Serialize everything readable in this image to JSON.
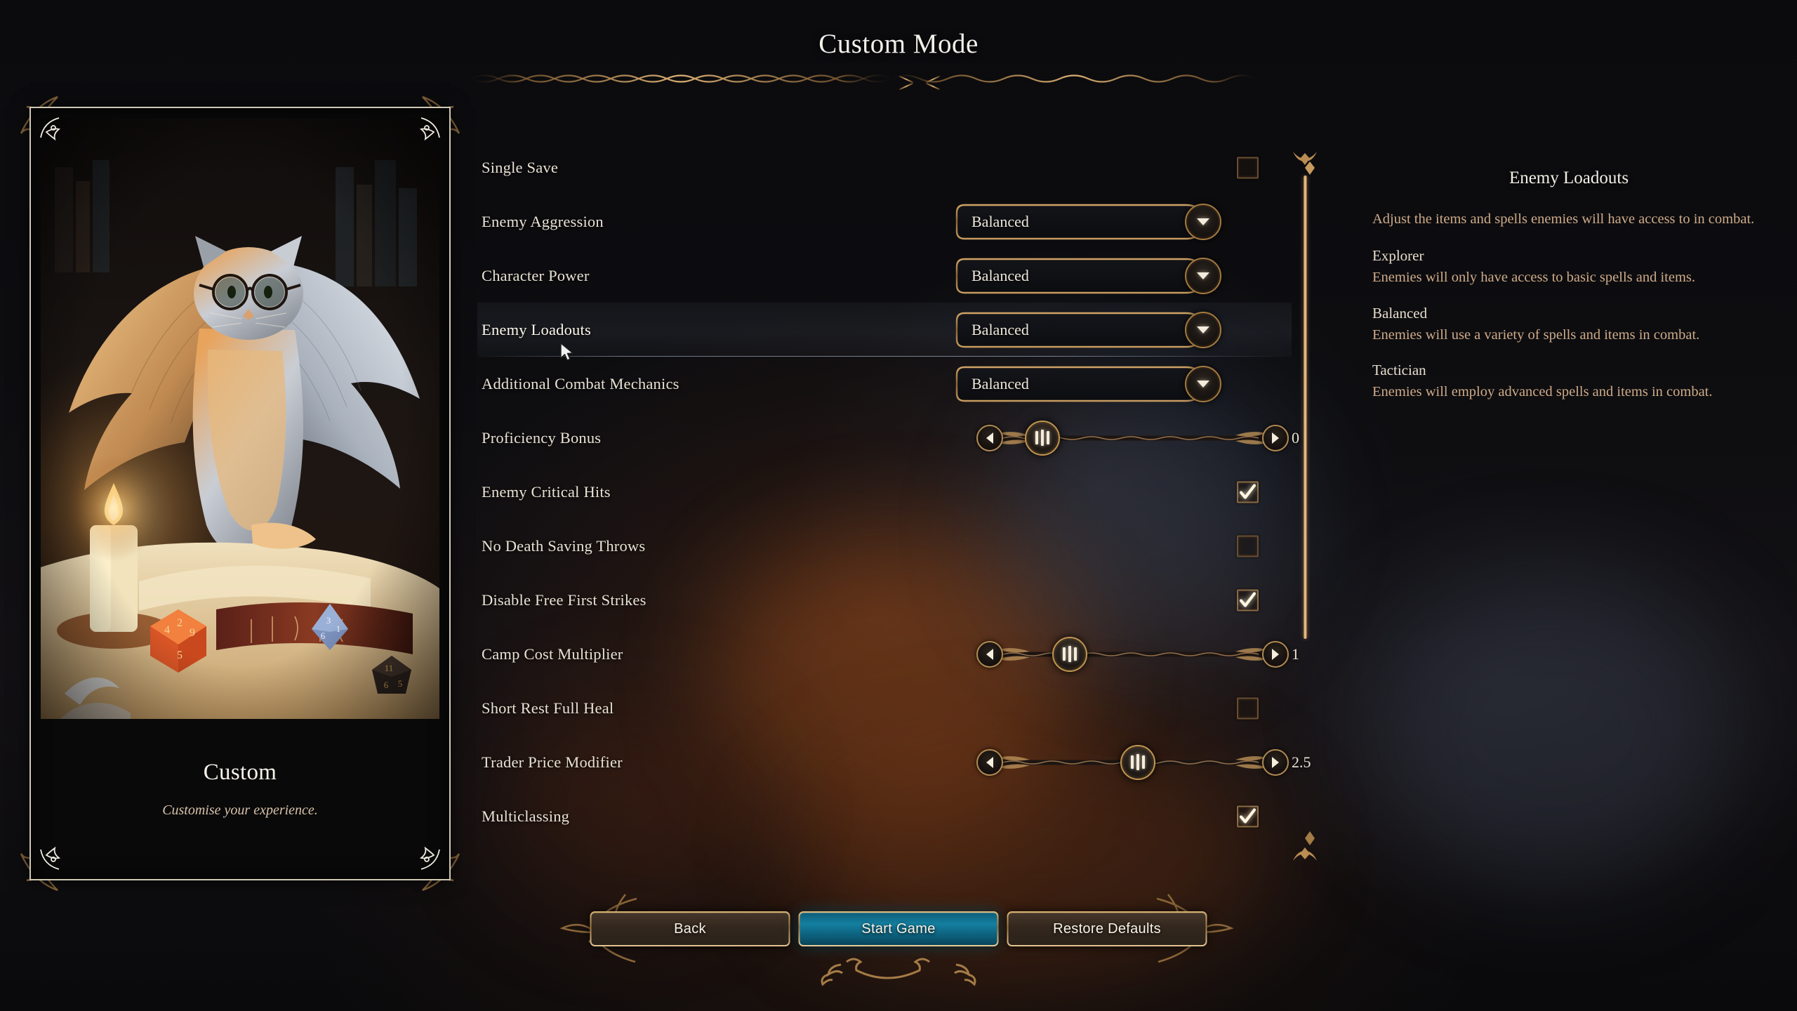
{
  "page": {
    "title": "Custom Mode"
  },
  "card": {
    "title": "Custom",
    "subtitle": "Customise your experience.",
    "artwork_name": "tressym-winged-cat-study-artwork"
  },
  "settings": [
    {
      "label": "Single Save",
      "type": "checkbox",
      "checked": false,
      "hover": false
    },
    {
      "label": "Enemy Aggression",
      "type": "dropdown",
      "value": "Balanced",
      "hover": false
    },
    {
      "label": "Character Power",
      "type": "dropdown",
      "value": "Balanced",
      "hover": false
    },
    {
      "label": "Enemy Loadouts",
      "type": "dropdown",
      "value": "Balanced",
      "hover": true
    },
    {
      "label": "Additional Combat Mechanics",
      "type": "dropdown",
      "value": "Balanced",
      "hover": false
    },
    {
      "label": "Proficiency Bonus",
      "type": "slider",
      "value": "0",
      "position_pct": 17,
      "hover": false
    },
    {
      "label": "Enemy Critical Hits",
      "type": "checkbox",
      "checked": true,
      "hover": false
    },
    {
      "label": "No Death Saving Throws",
      "type": "checkbox",
      "checked": false,
      "hover": false
    },
    {
      "label": "Disable Free First Strikes",
      "type": "checkbox",
      "checked": true,
      "hover": false
    },
    {
      "label": "Camp Cost Multiplier",
      "type": "slider",
      "value": "1",
      "position_pct": 27,
      "hover": false
    },
    {
      "label": "Short Rest Full Heal",
      "type": "checkbox",
      "checked": false,
      "hover": false
    },
    {
      "label": "Trader Price Modifier",
      "type": "slider",
      "value": "2.5",
      "position_pct": 52,
      "hover": false
    },
    {
      "label": "Multiclassing",
      "type": "checkbox",
      "checked": true,
      "hover": false
    }
  ],
  "info": {
    "title": "Enemy Loadouts",
    "description": "Adjust the items and spells enemies will have access to in combat.",
    "options": [
      {
        "name": "Explorer",
        "description": "Enemies will only have access to basic spells and items."
      },
      {
        "name": "Balanced",
        "description": "Enemies will use a variety of spells and items in combat."
      },
      {
        "name": "Tactician",
        "description": "Enemies will employ advanced spells and items in combat."
      }
    ]
  },
  "footer": {
    "back_label": "Back",
    "start_label": "Start Game",
    "restore_label": "Restore Defaults"
  },
  "colors": {
    "gold": "#c2954f",
    "gold_light": "#e8c68d",
    "bronze": "#8a6a42",
    "text_cream": "#e9e2d4",
    "text_tan": "#cfab88",
    "accent_teal": "#147fa0",
    "background": "#0a0a0c"
  }
}
